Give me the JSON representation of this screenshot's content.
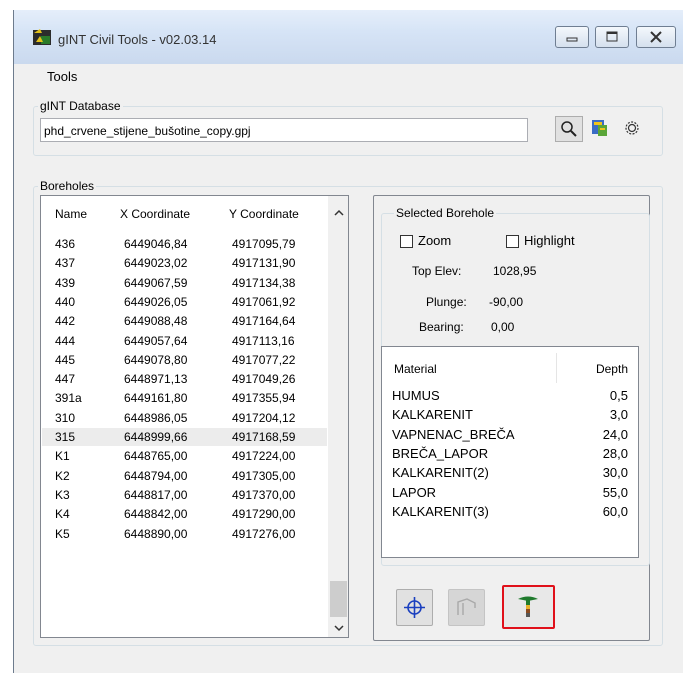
{
  "window": {
    "title": "gINT Civil Tools - v02.03.14"
  },
  "menu": {
    "tools": "Tools"
  },
  "database": {
    "group_label": "gINT Database",
    "file": "phd_crvene_stijene_bušotine_copy.gpj"
  },
  "boreholes": {
    "group_label": "Boreholes",
    "columns": [
      "Name",
      "X Coordinate",
      "Y Coordinate"
    ],
    "rows": [
      [
        "436",
        "6449046,84",
        "4917095,79"
      ],
      [
        "437",
        "6449023,02",
        "4917131,90"
      ],
      [
        "439",
        "6449067,59",
        "4917134,38"
      ],
      [
        "440",
        "6449026,05",
        "4917061,92"
      ],
      [
        "442",
        "6449088,48",
        "4917164,64"
      ],
      [
        "444",
        "6449057,64",
        "4917113,16"
      ],
      [
        "445",
        "6449078,80",
        "4917077,22"
      ],
      [
        "447",
        "6448971,13",
        "4917049,26"
      ],
      [
        "391a",
        "6449161,80",
        "4917355,94"
      ],
      [
        "310",
        "6448986,05",
        "4917204,12"
      ],
      [
        "315",
        "6448999,66",
        "4917168,59"
      ],
      [
        "K1",
        "6448765,00",
        "4917224,00"
      ],
      [
        "K2",
        "6448794,00",
        "4917305,00"
      ],
      [
        "K3",
        "6448817,00",
        "4917370,00"
      ],
      [
        "K4",
        "6448842,00",
        "4917290,00"
      ],
      [
        "K5",
        "6448890,00",
        "4917276,00"
      ]
    ],
    "selected_index": 10
  },
  "selected": {
    "group_label": "Selected Borehole",
    "zoom_label": "Zoom",
    "highlight_label": "Highlight",
    "top_elev_label": "Top Elev:",
    "top_elev": "1028,95",
    "plunge_label": "Plunge:",
    "plunge": "-90,00",
    "bearing_label": "Bearing:",
    "bearing": "0,00",
    "material_header": "Material",
    "depth_header": "Depth",
    "materials": [
      [
        "HUMUS",
        "0,5"
      ],
      [
        "KALKARENIT",
        "3,0"
      ],
      [
        "VAPNENAC_BREČA",
        "24,0"
      ],
      [
        "BREČA_LAPOR",
        "28,0"
      ],
      [
        "KALKARENIT(2)",
        "30,0"
      ],
      [
        "LAPOR",
        "55,0"
      ],
      [
        "KALKARENIT(3)",
        "60,0"
      ]
    ]
  },
  "colors": {
    "accent_red": "#e0101a",
    "chrome_blue": "#cad9ee"
  }
}
